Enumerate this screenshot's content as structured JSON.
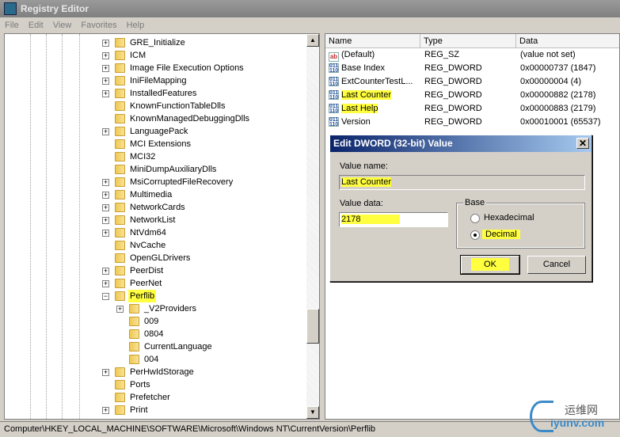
{
  "window": {
    "title": "Registry Editor"
  },
  "menu": [
    "File",
    "Edit",
    "View",
    "Favorites",
    "Help"
  ],
  "tree": [
    {
      "label": "GRE_Initialize",
      "level": 0,
      "expander": "+"
    },
    {
      "label": "ICM",
      "level": 0,
      "expander": "+"
    },
    {
      "label": "Image File Execution Options",
      "level": 0,
      "expander": "+"
    },
    {
      "label": "IniFileMapping",
      "level": 0,
      "expander": "+"
    },
    {
      "label": "InstalledFeatures",
      "level": 0,
      "expander": "+"
    },
    {
      "label": "KnownFunctionTableDlls",
      "level": 0,
      "expander": ""
    },
    {
      "label": "KnownManagedDebuggingDlls",
      "level": 0,
      "expander": ""
    },
    {
      "label": "LanguagePack",
      "level": 0,
      "expander": "+"
    },
    {
      "label": "MCI Extensions",
      "level": 0,
      "expander": ""
    },
    {
      "label": "MCI32",
      "level": 0,
      "expander": ""
    },
    {
      "label": "MiniDumpAuxiliaryDlls",
      "level": 0,
      "expander": ""
    },
    {
      "label": "MsiCorruptedFileRecovery",
      "level": 0,
      "expander": "+"
    },
    {
      "label": "Multimedia",
      "level": 0,
      "expander": "+"
    },
    {
      "label": "NetworkCards",
      "level": 0,
      "expander": "+"
    },
    {
      "label": "NetworkList",
      "level": 0,
      "expander": "+"
    },
    {
      "label": "NtVdm64",
      "level": 0,
      "expander": "+"
    },
    {
      "label": "NvCache",
      "level": 0,
      "expander": ""
    },
    {
      "label": "OpenGLDrivers",
      "level": 0,
      "expander": ""
    },
    {
      "label": "PeerDist",
      "level": 0,
      "expander": "+"
    },
    {
      "label": "PeerNet",
      "level": 0,
      "expander": "+"
    },
    {
      "label": "Perflib",
      "level": 0,
      "expander": "-",
      "selected": true
    },
    {
      "label": "_V2Providers",
      "level": 1,
      "expander": "+"
    },
    {
      "label": "009",
      "level": 1,
      "expander": ""
    },
    {
      "label": "0804",
      "level": 1,
      "expander": ""
    },
    {
      "label": "CurrentLanguage",
      "level": 1,
      "expander": ""
    },
    {
      "label": "004",
      "level": 1,
      "expander": ""
    },
    {
      "label": "PerHwIdStorage",
      "level": 0,
      "expander": "+"
    },
    {
      "label": "Ports",
      "level": 0,
      "expander": ""
    },
    {
      "label": "Prefetcher",
      "level": 0,
      "expander": ""
    },
    {
      "label": "Print",
      "level": 0,
      "expander": "+"
    }
  ],
  "list": {
    "columns": [
      "Name",
      "Type",
      "Data"
    ],
    "rows": [
      {
        "icon": "string-value-icon",
        "name": "(Default)",
        "type": "REG_SZ",
        "data": "(value not set)"
      },
      {
        "icon": "binary-value-icon",
        "name": "Base Index",
        "type": "REG_DWORD",
        "data": "0x00000737 (1847)"
      },
      {
        "icon": "binary-value-icon",
        "name": "ExtCounterTestL...",
        "type": "REG_DWORD",
        "data": "0x00000004 (4)"
      },
      {
        "icon": "binary-value-icon",
        "name": "Last Counter",
        "type": "REG_DWORD",
        "data": "0x00000882 (2178)",
        "hl": true
      },
      {
        "icon": "binary-value-icon",
        "name": "Last Help",
        "type": "REG_DWORD",
        "data": "0x00000883 (2179)",
        "hl": true
      },
      {
        "icon": "binary-value-icon",
        "name": "Version",
        "type": "REG_DWORD",
        "data": "0x00010001 (65537)"
      }
    ]
  },
  "dialog": {
    "title": "Edit DWORD (32-bit) Value",
    "close": "✕",
    "value_name_label": "Value name:",
    "value_name": "Last Counter",
    "value_data_label": "Value data:",
    "value_data": "2178",
    "base_label": "Base",
    "hex_label": "Hexadecimal",
    "dec_label": "Decimal",
    "base_selected": "Decimal",
    "ok": "OK",
    "cancel": "Cancel"
  },
  "status": "Computer\\HKEY_LOCAL_MACHINE\\SOFTWARE\\Microsoft\\Windows NT\\CurrentVersion\\Perflib",
  "watermark": {
    "cn": "运维网",
    "en": "iyunv.com"
  },
  "colors": {
    "highlight": "#ffff40",
    "dialog_title": "#0a246a"
  }
}
